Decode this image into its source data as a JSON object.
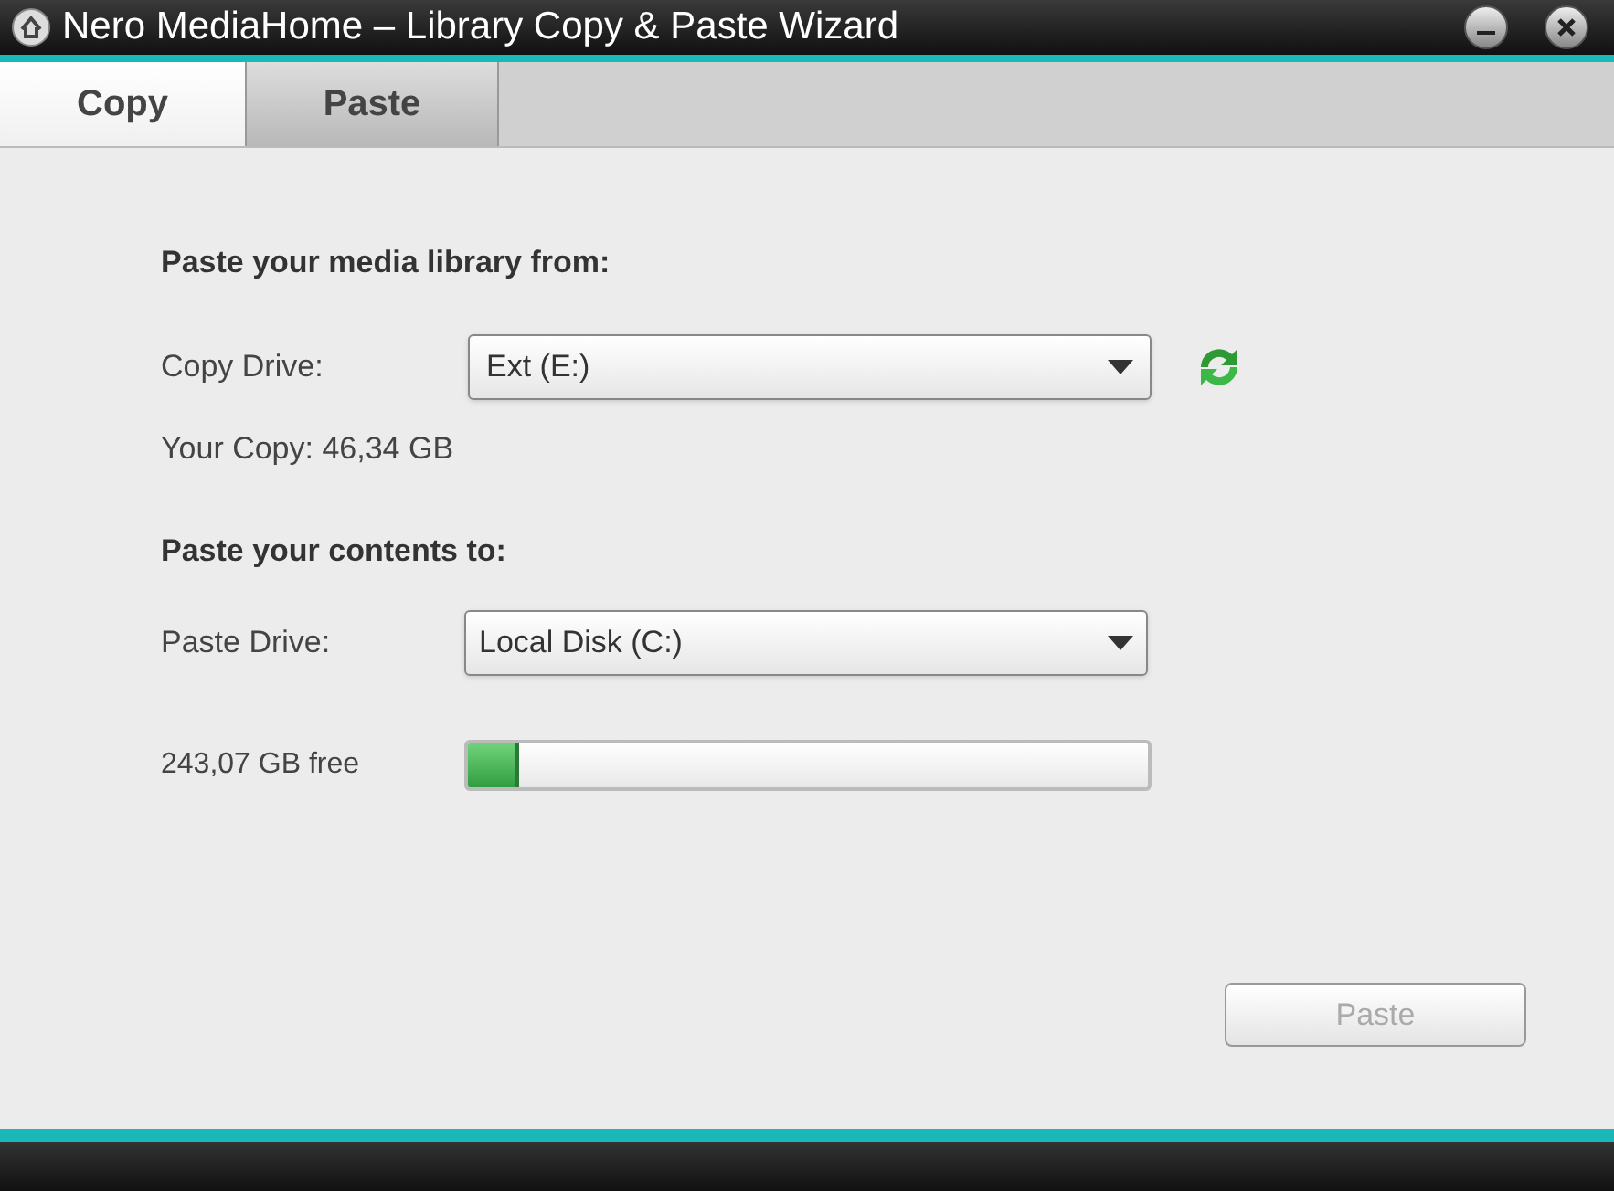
{
  "window": {
    "title": "Nero MediaHome – Library Copy & Paste Wizard"
  },
  "tabs": [
    {
      "label": "Copy",
      "selected": false
    },
    {
      "label": "Paste",
      "selected": true
    }
  ],
  "source": {
    "heading": "Paste your media library from:",
    "drive_label": "Copy Drive:",
    "drive_value": "Ext (E:)",
    "copy_size": "Your Copy: 46,34 GB"
  },
  "target": {
    "heading": "Paste your contents to:",
    "drive_label": "Paste Drive:",
    "drive_value": "Local Disk (C:)",
    "free_label": "243,07 GB free",
    "level": 0.075
  },
  "paste_button": {
    "label": "Paste",
    "disabled": true
  }
}
